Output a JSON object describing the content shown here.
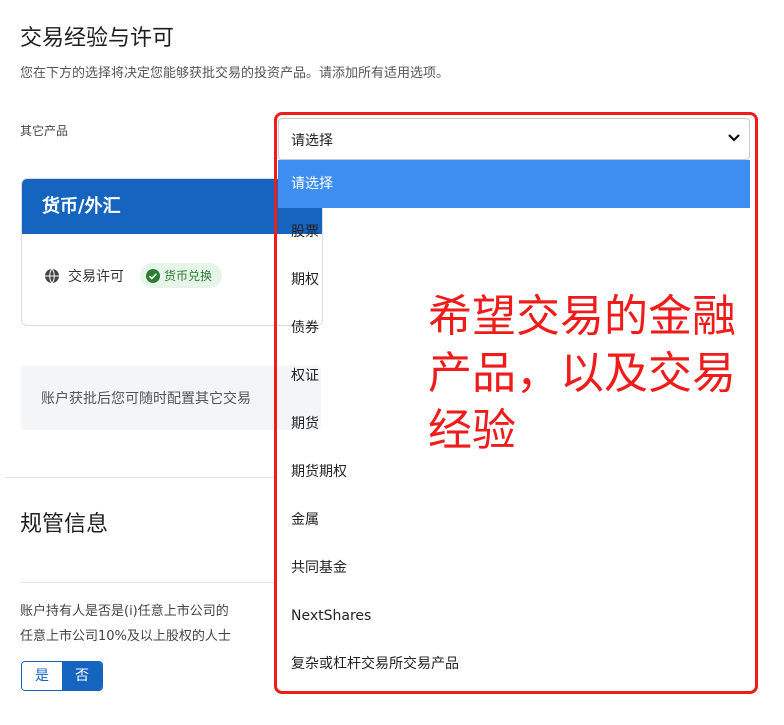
{
  "page": {
    "title": "交易经验与许可",
    "subtitle": "您在下方的选择将决定您能够获批交易的投资产品。请添加所有适用选项。"
  },
  "other_products": {
    "label": "其它产品",
    "selected": "请选择",
    "options": [
      "请选择",
      "股票",
      "期权",
      "债券",
      "权证",
      "期货",
      "期货期权",
      "金属",
      "共同基金",
      "NextShares",
      "复杂或杠杆交易所交易产品"
    ]
  },
  "card": {
    "title": "货币/外汇",
    "row_label": "交易许可",
    "badge": "货币兑换",
    "icons": {
      "globe": "globe-icon",
      "check": "check-circle-icon"
    }
  },
  "info": {
    "text": "账户获批后您可随时配置其它交易"
  },
  "regulatory": {
    "title": "规管信息",
    "q_line1": "账户持有人是否是(i)任意上市公司的",
    "q_line2": "任意上市公司10%及以上股权的人士",
    "yes": "是",
    "no": "否"
  },
  "annotation": {
    "text": "希望交易的金融产品，以及交易经验"
  },
  "colors": {
    "brand_blue": "#1565c0",
    "selected_option": "#3d8ef0",
    "annotation_red": "#ef1c1c",
    "badge_green": "#2e7d32"
  }
}
